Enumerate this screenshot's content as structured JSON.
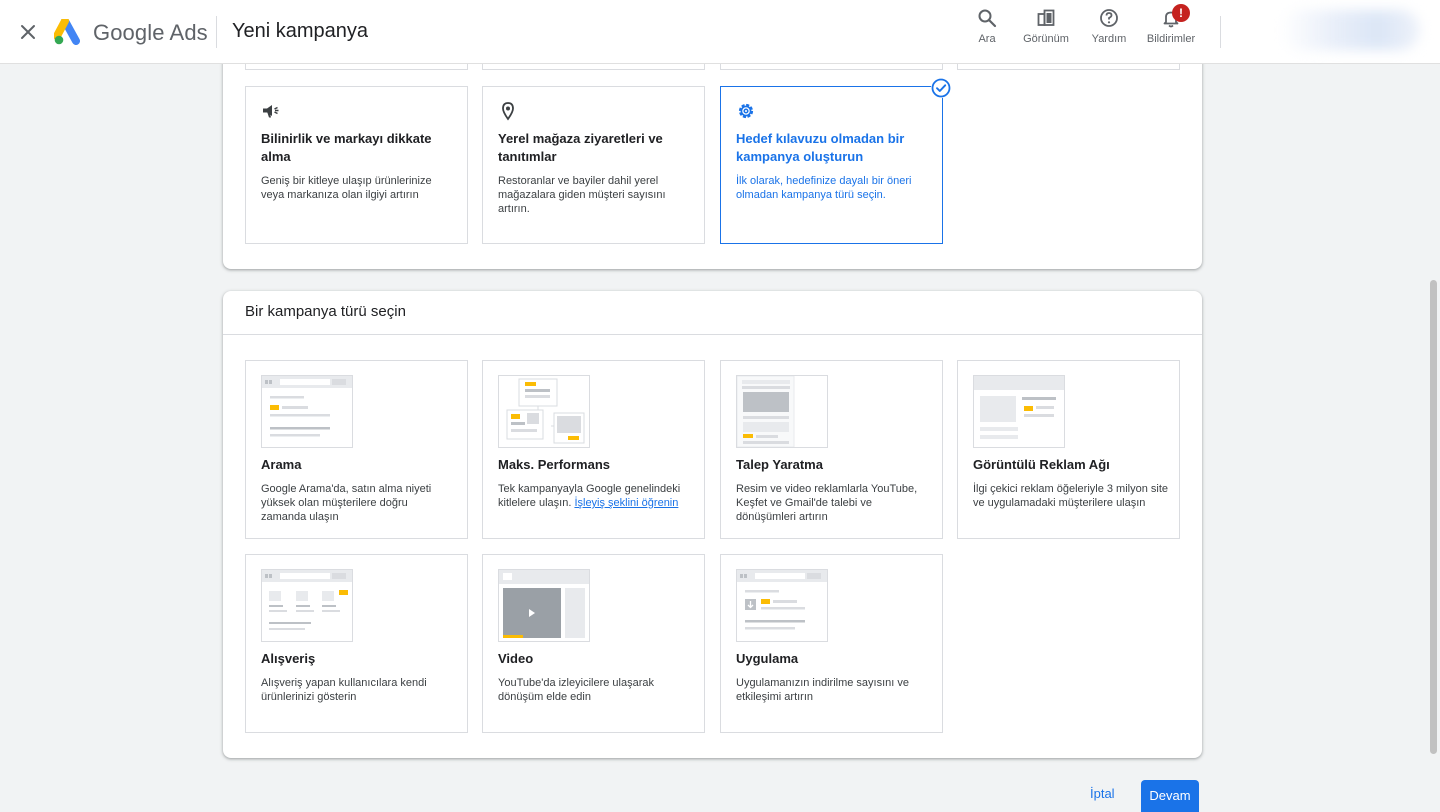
{
  "header": {
    "brand": "Google Ads",
    "title": "Yeni kampanya",
    "actions": [
      {
        "label": "Ara",
        "icon": "search-icon"
      },
      {
        "label": "Görünüm",
        "icon": "appearance-icon"
      },
      {
        "label": "Yardım",
        "icon": "help-icon"
      },
      {
        "label": "Bildirimler",
        "icon": "bell-icon",
        "badge": "!"
      }
    ]
  },
  "objectives": [
    {
      "title": "Bilinirlik ve markayı dikkate alma",
      "description": "Geniş bir kitleye ulaşıp ürünlerinize veya markanıza olan ilgiyi artırın",
      "icon": "megaphone-icon",
      "selected": false
    },
    {
      "title": "Yerel mağaza ziyaretleri ve tanıtımlar",
      "description": "Restoranlar ve bayiler dahil yerel mağazalara giden müşteri sayısını artırın.",
      "icon": "location-pin-icon",
      "selected": false
    },
    {
      "title": "Hedef kılavuzu olmadan bir kampanya oluşturun",
      "description": "İlk olarak, hedefinize dayalı bir öneri olmadan kampanya türü seçin.",
      "icon": "gear-icon",
      "selected": true
    }
  ],
  "campaign_section": {
    "heading": "Bir kampanya türü seçin",
    "types": [
      {
        "title": "Arama",
        "description": "Google Arama'da, satın alma niyeti yüksek olan müşterilere doğru zamanda ulaşın"
      },
      {
        "title": "Maks. Performans",
        "description": "Tek kampanyayla Google genelindeki kitlelere ulaşın.",
        "link": "İşleyiş şeklini öğrenin"
      },
      {
        "title": "Talep Yaratma",
        "description": "Resim ve video reklamlarla YouTube, Keşfet ve Gmail'de talebi ve dönüşümleri artırın"
      },
      {
        "title": "Görüntülü Reklam Ağı",
        "description": "İlgi çekici reklam öğeleriyle 3 milyon site ve uygulamadaki müşterilere ulaşın"
      },
      {
        "title": "Alışveriş",
        "description": "Alışveriş yapan kullanıcılara kendi ürünlerinizi gösterin"
      },
      {
        "title": "Video",
        "description": "YouTube'da izleyicilere ulaşarak dönüşüm elde edin"
      },
      {
        "title": "Uygulama",
        "description": "Uygulamanızın indirilme sayısını ve etkileşimi artırın"
      }
    ]
  },
  "footer": {
    "cancel": "İptal",
    "continue": "Devam"
  },
  "colors": {
    "accent": "#1a73e8",
    "thumb_highlight": "#fbbc04",
    "badge": "#c5221f"
  }
}
